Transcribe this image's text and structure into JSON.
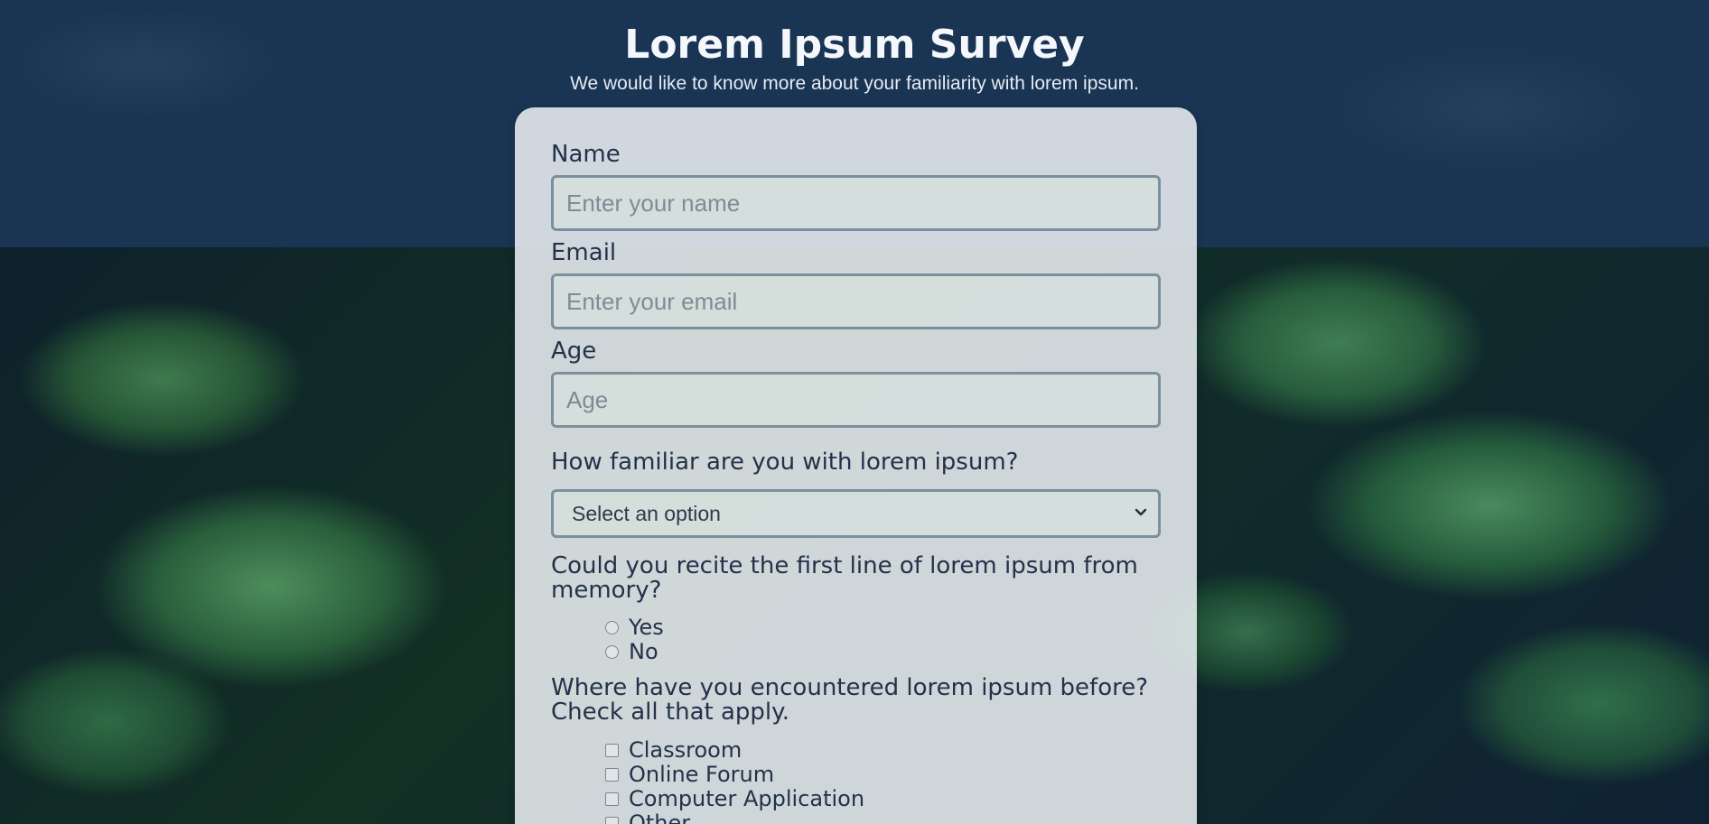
{
  "header": {
    "title": "Lorem Ipsum Survey",
    "subtitle": "We would like to know more about your familiarity with lorem ipsum."
  },
  "form": {
    "name": {
      "label": "Name",
      "placeholder": "Enter your name",
      "value": ""
    },
    "email": {
      "label": "Email",
      "placeholder": "Enter your email",
      "value": ""
    },
    "age": {
      "label": "Age",
      "placeholder": "Age",
      "value": ""
    },
    "familiarity": {
      "label": "How familiar are you with lorem ipsum?",
      "selected": "Select an option"
    },
    "recite": {
      "label": "Could you recite the first line of lorem ipsum from memory?",
      "options": [
        "Yes",
        "No"
      ]
    },
    "encountered": {
      "label": "Where have you encountered lorem ipsum before? Check all that apply.",
      "options": [
        "Classroom",
        "Online Forum",
        "Computer Application",
        "Other"
      ]
    }
  },
  "icons": {
    "select": "chevron-down-icon"
  },
  "colors": {
    "header_band": "#1b3555",
    "card_background": "#ecf0f4",
    "text_primary": "#23324a",
    "field_border": "#7b909d"
  }
}
